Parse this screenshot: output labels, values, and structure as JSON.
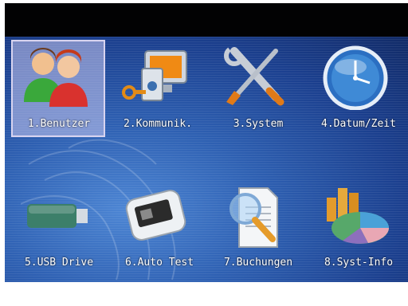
{
  "menu": {
    "items": [
      {
        "label": "1.Benutzer",
        "icon": "users-icon",
        "selected": true
      },
      {
        "label": "2.Kommunik.",
        "icon": "computer-key-icon",
        "selected": false
      },
      {
        "label": "3.System",
        "icon": "tools-icon",
        "selected": false
      },
      {
        "label": "4.Datum/Zeit",
        "icon": "clock-icon",
        "selected": false
      },
      {
        "label": "5.USB Drive",
        "icon": "usb-drive-icon",
        "selected": false
      },
      {
        "label": "6.Auto Test",
        "icon": "device-test-icon",
        "selected": false
      },
      {
        "label": "7.Buchungen",
        "icon": "document-search-icon",
        "selected": false
      },
      {
        "label": "8.Syst-Info",
        "icon": "pie-chart-icon",
        "selected": false
      }
    ]
  },
  "colors": {
    "background": "#2e60b2",
    "selection": "#d8d4f0",
    "label": "#ffffff"
  }
}
